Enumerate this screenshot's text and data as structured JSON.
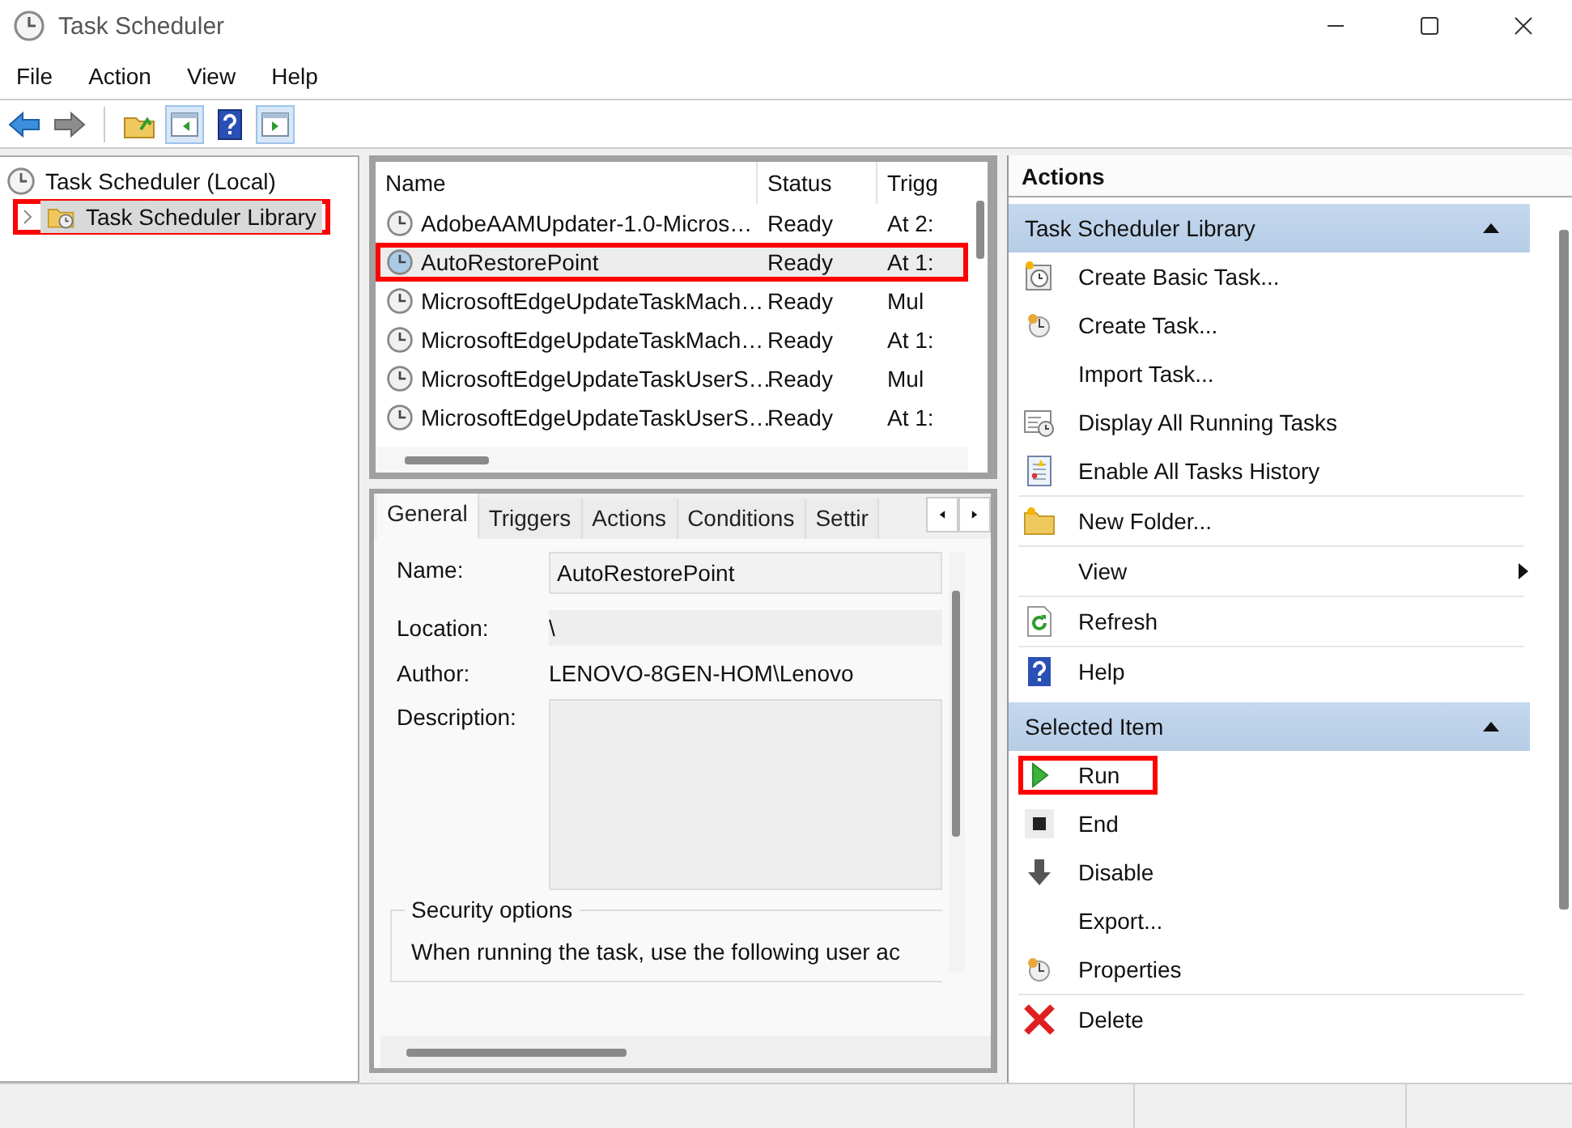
{
  "window": {
    "title": "Task Scheduler"
  },
  "menu": [
    "File",
    "Action",
    "View",
    "Help"
  ],
  "tree": {
    "label": "Task Scheduler (Local)",
    "children": [
      {
        "label": "Task Scheduler Library",
        "expanded": false,
        "selected": true,
        "highlighted": true
      }
    ]
  },
  "task_list": {
    "columns": [
      "Name",
      "Status",
      "Trigg"
    ],
    "rows": [
      {
        "name": "AdobeAAMUpdater-1.0-Micros…",
        "status": "Ready",
        "trigger": "At 2:",
        "selected": false,
        "highlighted": false
      },
      {
        "name": "AutoRestorePoint",
        "status": "Ready",
        "trigger": "At 1:",
        "selected": true,
        "highlighted": true
      },
      {
        "name": "MicrosoftEdgeUpdateTaskMach…",
        "status": "Ready",
        "trigger": "Mul",
        "selected": false,
        "highlighted": false
      },
      {
        "name": "MicrosoftEdgeUpdateTaskMach…",
        "status": "Ready",
        "trigger": "At 1:",
        "selected": false,
        "highlighted": false
      },
      {
        "name": "MicrosoftEdgeUpdateTaskUserS…",
        "status": "Ready",
        "trigger": "Mul",
        "selected": false,
        "highlighted": false
      },
      {
        "name": "MicrosoftEdgeUpdateTaskUserS…",
        "status": "Ready",
        "trigger": "At 1:",
        "selected": false,
        "highlighted": false
      }
    ]
  },
  "details": {
    "tabs": [
      {
        "label": "General",
        "selected": true
      },
      {
        "label": "Triggers",
        "selected": false
      },
      {
        "label": "Actions",
        "selected": false
      },
      {
        "label": "Conditions",
        "selected": false
      },
      {
        "label": "Settir",
        "selected": false
      }
    ],
    "fields": [
      {
        "label": "Name:",
        "value": "AutoRestorePoint",
        "kind": "box"
      },
      {
        "label": "Location:",
        "value": "\\",
        "kind": "shaded"
      },
      {
        "label": "Author:",
        "value": "LENOVO-8GEN-HOM\\Lenovo",
        "kind": "plain"
      },
      {
        "label": "Description:",
        "kind": "area"
      }
    ],
    "security": {
      "title": "Security options",
      "text": "When running the task, use the following user ac"
    }
  },
  "actions_pane": {
    "title": "Actions",
    "sections": [
      {
        "title": "Task Scheduler Library",
        "expanded": true,
        "groups": [
          {
            "items": [
              {
                "label": "Create Basic Task...",
                "kind": "command",
                "highlighted": false
              },
              {
                "label": "Create Task...",
                "kind": "command",
                "highlighted": false
              },
              {
                "label": "Import Task...",
                "kind": "command",
                "highlighted": false
              },
              {
                "label": "Display All Running Tasks",
                "kind": "command",
                "highlighted": false
              },
              {
                "label": "Enable All Tasks History",
                "kind": "command",
                "highlighted": false
              }
            ]
          },
          {
            "items": [
              {
                "label": "New Folder...",
                "kind": "command",
                "highlighted": false
              }
            ]
          },
          {
            "items": [
              {
                "label": "View",
                "kind": "submenu",
                "highlighted": false
              }
            ]
          },
          {
            "items": [
              {
                "label": "Refresh",
                "kind": "command",
                "highlighted": false
              }
            ]
          },
          {
            "items": [
              {
                "label": "Help",
                "kind": "command",
                "highlighted": false
              }
            ]
          }
        ]
      },
      {
        "title": "Selected Item",
        "expanded": true,
        "groups": [
          {
            "items": [
              {
                "label": "Run",
                "kind": "command",
                "highlighted": true
              },
              {
                "label": "End",
                "kind": "command",
                "highlighted": false
              },
              {
                "label": "Disable",
                "kind": "command",
                "highlighted": false
              },
              {
                "label": "Export...",
                "kind": "command",
                "highlighted": false
              },
              {
                "label": "Properties",
                "kind": "command",
                "highlighted": false
              }
            ]
          },
          {
            "items": [
              {
                "label": "Delete",
                "kind": "command",
                "highlighted": false
              }
            ]
          }
        ]
      }
    ]
  }
}
